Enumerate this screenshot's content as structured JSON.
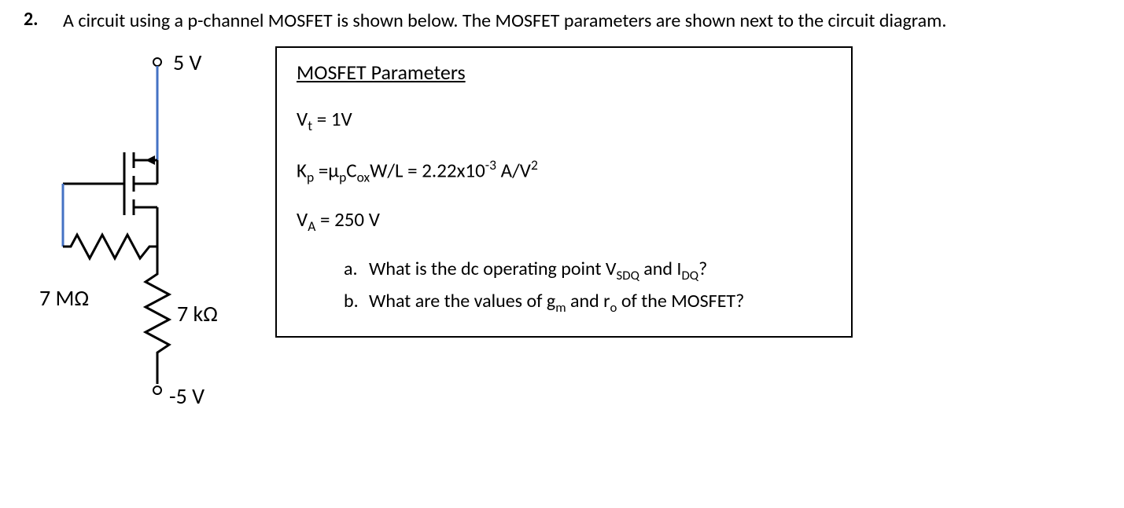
{
  "problem_number": "2.",
  "intro": "A circuit using a p-channel MOSFET is shown below. The MOSFET parameters are shown next to the circuit diagram.",
  "circuit": {
    "top_voltage": "5 V",
    "bottom_voltage": "-5 V",
    "r_gate": "7 MΩ",
    "r_drain": "7 kΩ"
  },
  "params": {
    "title": "MOSFET Parameters",
    "vt": "1V",
    "kp": "2.22x10",
    "kp_exp": "-3",
    "kp_unit": "A/V",
    "va": "250 V"
  },
  "questions": {
    "a_letter": "a.",
    "a_text_1": "What is the dc operating point V",
    "a_sub_1": "SDQ",
    "a_text_2": "  and I",
    "a_sub_2": "DQ",
    "a_text_3": "?",
    "b_letter": "b.",
    "b_text_1": "What are the values of g",
    "b_sub_1": "m",
    "b_text_2": " and r",
    "b_sub_2": "o",
    "b_text_3": " of the MOSFET?"
  }
}
